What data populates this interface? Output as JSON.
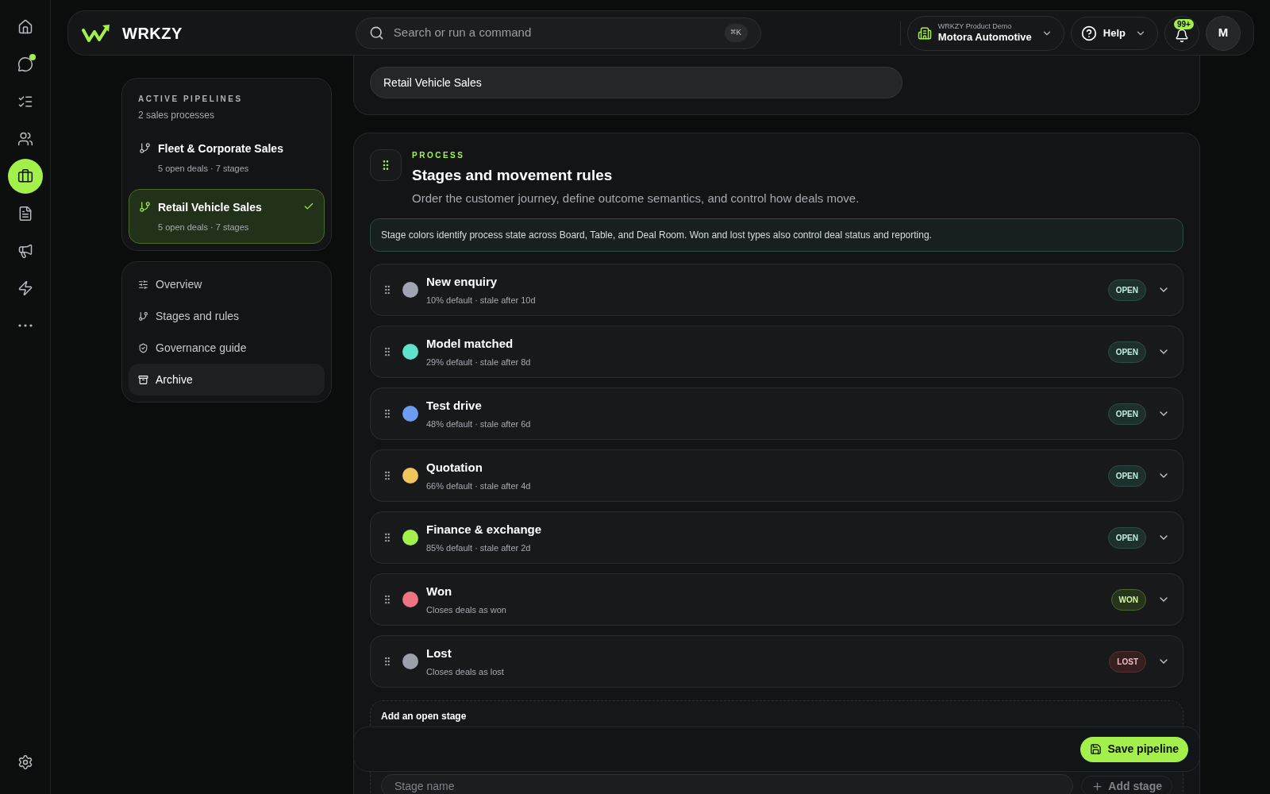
{
  "rail": {
    "items": [
      {
        "selected": false,
        "dot": false
      },
      {
        "selected": false,
        "dot": true
      },
      {
        "selected": false,
        "dot": false
      },
      {
        "selected": false,
        "dot": false
      },
      {
        "selected": true,
        "dot": false
      },
      {
        "selected": false,
        "dot": false
      },
      {
        "selected": false,
        "dot": false
      },
      {
        "selected": false,
        "dot": false
      },
      {
        "selected": false,
        "dot": false
      }
    ]
  },
  "header": {
    "brand": "WRKZY",
    "search": {
      "placeholder": "Search or run a command",
      "shortcut": "⌘K"
    },
    "workspace": {
      "caption": "WRKZY Product Demo",
      "name": "Motora Automotive"
    },
    "help": "Help",
    "notifications": "99+",
    "avatar": "M"
  },
  "pipelines": {
    "title": "ACTIVE PIPELINES",
    "subtitle": "2 sales processes",
    "items": [
      {
        "name": "Fleet & Corporate Sales",
        "meta": "5 open deals · 7 stages",
        "selected": false
      },
      {
        "name": "Retail Vehicle Sales",
        "meta": "5 open deals · 7 stages",
        "selected": true
      }
    ]
  },
  "sections": [
    {
      "label": "Overview",
      "selected": false
    },
    {
      "label": "Stages and rules",
      "selected": false
    },
    {
      "label": "Governance guide",
      "selected": false
    },
    {
      "label": "Archive",
      "selected": true
    }
  ],
  "pipeline_name": {
    "value": "Retail Vehicle Sales"
  },
  "process": {
    "eyebrow": "PROCESS",
    "title": "Stages and movement rules",
    "description": "Order the customer journey, define outcome semantics, and control how deals move.",
    "notice": "Stage colors identify process state across Board, Table, and Deal Room. Won and lost types also control deal status and reporting.",
    "stages": [
      {
        "name": "New enquiry",
        "meta": "10% default · stale after 10d",
        "color": "#a1a4b3",
        "kind": "open",
        "badge": "OPEN"
      },
      {
        "name": "Model matched",
        "meta": "29% default · stale after 8d",
        "color": "#5fe3cc",
        "kind": "open",
        "badge": "OPEN"
      },
      {
        "name": "Test drive",
        "meta": "48% default · stale after 6d",
        "color": "#6d9df2",
        "kind": "open",
        "badge": "OPEN"
      },
      {
        "name": "Quotation",
        "meta": "66% default · stale after 4d",
        "color": "#f2c55c",
        "kind": "open",
        "badge": "OPEN"
      },
      {
        "name": "Finance & exchange",
        "meta": "85% default · stale after 2d",
        "color": "#a3ef4b",
        "kind": "open",
        "badge": "OPEN"
      },
      {
        "name": "Won",
        "meta": "Closes deals as won",
        "color": "#ee7483",
        "kind": "won",
        "badge": "WON"
      },
      {
        "name": "Lost",
        "meta": "Closes deals as lost",
        "color": "#9ca0ad",
        "kind": "lost",
        "badge": "LOST"
      }
    ],
    "add": {
      "title": "Add an open stage",
      "placeholder": "Stage name",
      "button": "Add stage"
    }
  },
  "save_button": "Save pipeline"
}
